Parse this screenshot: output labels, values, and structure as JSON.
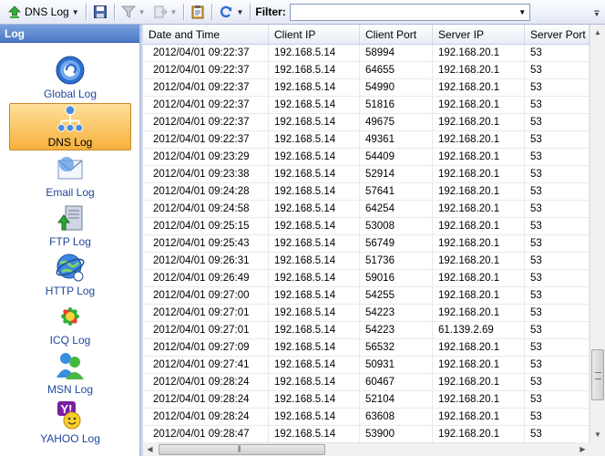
{
  "toolbar": {
    "log_type_label": "DNS Log",
    "filter_label": "Filter:",
    "filter_value": ""
  },
  "sidebar": {
    "header": "Log",
    "items": [
      {
        "label": "Global Log",
        "icon": "global-log-icon",
        "active": false
      },
      {
        "label": "DNS Log",
        "icon": "dns-log-icon",
        "active": true
      },
      {
        "label": "Email Log",
        "icon": "email-log-icon",
        "active": false
      },
      {
        "label": "FTP Log",
        "icon": "ftp-log-icon",
        "active": false
      },
      {
        "label": "HTTP Log",
        "icon": "http-log-icon",
        "active": false
      },
      {
        "label": "ICQ Log",
        "icon": "icq-log-icon",
        "active": false
      },
      {
        "label": "MSN Log",
        "icon": "msn-log-icon",
        "active": false
      },
      {
        "label": "YAHOO Log",
        "icon": "yahoo-log-icon",
        "active": false
      }
    ]
  },
  "table": {
    "columns": [
      "Date and Time",
      "Client IP",
      "Client Port",
      "Server IP",
      "Server Port"
    ],
    "rows": [
      [
        "2012/04/01 09:22:37",
        "192.168.5.14",
        "58994",
        "192.168.20.1",
        "53"
      ],
      [
        "2012/04/01 09:22:37",
        "192.168.5.14",
        "64655",
        "192.168.20.1",
        "53"
      ],
      [
        "2012/04/01 09:22:37",
        "192.168.5.14",
        "54990",
        "192.168.20.1",
        "53"
      ],
      [
        "2012/04/01 09:22:37",
        "192.168.5.14",
        "51816",
        "192.168.20.1",
        "53"
      ],
      [
        "2012/04/01 09:22:37",
        "192.168.5.14",
        "49675",
        "192.168.20.1",
        "53"
      ],
      [
        "2012/04/01 09:22:37",
        "192.168.5.14",
        "49361",
        "192.168.20.1",
        "53"
      ],
      [
        "2012/04/01 09:23:29",
        "192.168.5.14",
        "54409",
        "192.168.20.1",
        "53"
      ],
      [
        "2012/04/01 09:23:38",
        "192.168.5.14",
        "52914",
        "192.168.20.1",
        "53"
      ],
      [
        "2012/04/01 09:24:28",
        "192.168.5.14",
        "57641",
        "192.168.20.1",
        "53"
      ],
      [
        "2012/04/01 09:24:58",
        "192.168.5.14",
        "64254",
        "192.168.20.1",
        "53"
      ],
      [
        "2012/04/01 09:25:15",
        "192.168.5.14",
        "53008",
        "192.168.20.1",
        "53"
      ],
      [
        "2012/04/01 09:25:43",
        "192.168.5.14",
        "56749",
        "192.168.20.1",
        "53"
      ],
      [
        "2012/04/01 09:26:31",
        "192.168.5.14",
        "51736",
        "192.168.20.1",
        "53"
      ],
      [
        "2012/04/01 09:26:49",
        "192.168.5.14",
        "59016",
        "192.168.20.1",
        "53"
      ],
      [
        "2012/04/01 09:27:00",
        "192.168.5.14",
        "54255",
        "192.168.20.1",
        "53"
      ],
      [
        "2012/04/01 09:27:01",
        "192.168.5.14",
        "54223",
        "192.168.20.1",
        "53"
      ],
      [
        "2012/04/01 09:27:01",
        "192.168.5.14",
        "54223",
        "61.139.2.69",
        "53"
      ],
      [
        "2012/04/01 09:27:09",
        "192.168.5.14",
        "56532",
        "192.168.20.1",
        "53"
      ],
      [
        "2012/04/01 09:27:41",
        "192.168.5.14",
        "50931",
        "192.168.20.1",
        "53"
      ],
      [
        "2012/04/01 09:28:24",
        "192.168.5.14",
        "60467",
        "192.168.20.1",
        "53"
      ],
      [
        "2012/04/01 09:28:24",
        "192.168.5.14",
        "52104",
        "192.168.20.1",
        "53"
      ],
      [
        "2012/04/01 09:28:24",
        "192.168.5.14",
        "63608",
        "192.168.20.1",
        "53"
      ],
      [
        "2012/04/01 09:28:47",
        "192.168.5.14",
        "53900",
        "192.168.20.1",
        "53"
      ]
    ]
  },
  "colors": {
    "sidebar_header": "#4a78c4",
    "active_item": "#f7b13c",
    "nav_label": "#21479c"
  }
}
